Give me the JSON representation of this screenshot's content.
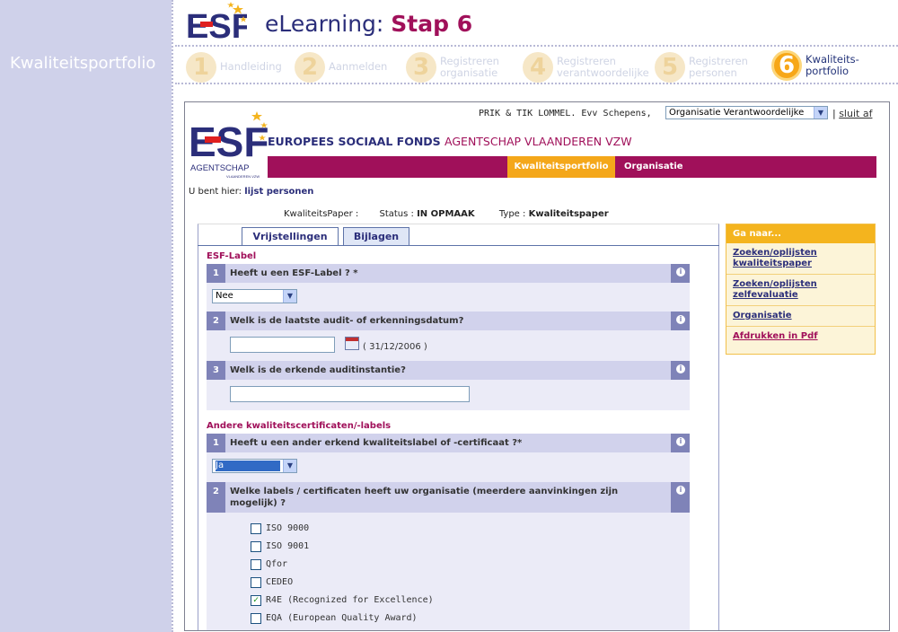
{
  "sidebar": {
    "title": "Kwaliteitsportfolio"
  },
  "header": {
    "logo": "ESF",
    "title_prefix": "eLearning:",
    "title_bold": "Stap 6"
  },
  "steps": [
    {
      "num": "1",
      "label": "Handleiding"
    },
    {
      "num": "2",
      "label": "Aanmelden"
    },
    {
      "num": "3",
      "label": "Registreren organisatie"
    },
    {
      "num": "4",
      "label": "Registreren verantwoordelijke"
    },
    {
      "num": "5",
      "label": "Registreren personen"
    },
    {
      "num": "6",
      "label": "Kwaliteits-portfolio"
    }
  ],
  "topbar": {
    "user": "PRIK & TIK LOMMEL.  Evv Schepens,",
    "role": "Organisatie Verantwoordelijke",
    "logout": "sluit af"
  },
  "esf": {
    "logo_text": "ESF",
    "agentschap": "AGENTSCHAP",
    "vzw": "VLAANDEREN VZW",
    "title_bold": "EUROPEES SOCIAAL FONDS",
    "title_rest": "AGENTSCHAP VLAANDEREN VZW"
  },
  "menu": {
    "item1": "Kwaliteitsportfolio",
    "item2": "Organisatie"
  },
  "breadcrumb": {
    "prefix": "U bent hier:",
    "link": "lijst personen"
  },
  "meta": {
    "paper": "KwaliteitsPaper :",
    "status_label": "Status :",
    "status_value": "IN OPMAAK",
    "type_label": "Type :",
    "type_value": "Kwaliteitspaper"
  },
  "tabs": {
    "tab1": "Vrijstellingen",
    "tab2": "Bijlagen"
  },
  "section1": {
    "title": "ESF-Label",
    "q1": {
      "num": "1",
      "text": "Heeft u een ESF-Label ? *",
      "value": "Nee"
    },
    "q2": {
      "num": "2",
      "text": "Welk is de laatste audit- of erkenningsdatum?",
      "hint": "( 31/12/2006 )"
    },
    "q3": {
      "num": "3",
      "text": "Welk is de erkende auditinstantie?"
    }
  },
  "section2": {
    "title": "Andere kwaliteitscertificaten/-labels",
    "q1": {
      "num": "1",
      "text": "Heeft u een ander erkend kwaliteitslabel of -certificaat ?*",
      "value": "Ja"
    },
    "q2": {
      "num": "2",
      "text": "Welke labels / certificaten heeft uw organisatie (meerdere aanvinkingen zijn mogelijk) ?"
    },
    "options": [
      {
        "label": "ISO 9000",
        "checked": false
      },
      {
        "label": "ISO 9001",
        "checked": false
      },
      {
        "label": "Qfor",
        "checked": false
      },
      {
        "label": "CEDEO",
        "checked": false
      },
      {
        "label": "R4E (Recognized for Excellence)",
        "checked": true
      },
      {
        "label": "EQA (European Quality Award)",
        "checked": false
      }
    ]
  },
  "info_icon": "i",
  "goto": {
    "title": "Ga naar...",
    "links": [
      "Zoeken/oplijsten kwaliteitspaper",
      "Zoeken/oplijsten zelfevaluatie",
      "Organisatie"
    ],
    "pdf": "Afdrukken in Pdf"
  },
  "colors": {
    "brand_blue": "#2b2e7a",
    "brand_purple": "#a0105a",
    "accent_orange": "#f4a71a",
    "question_bar": "#d1d2ec"
  }
}
